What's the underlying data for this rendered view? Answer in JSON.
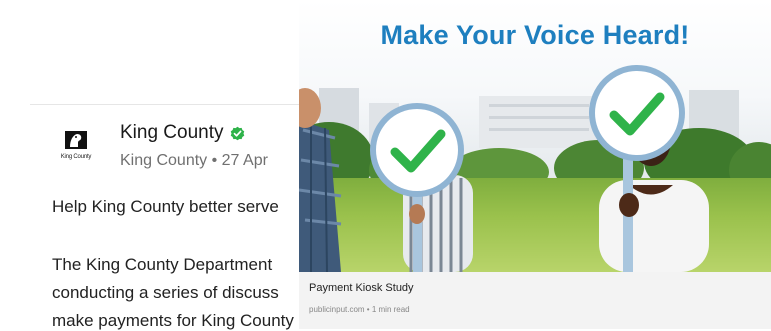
{
  "post": {
    "author": "King County",
    "meta": "King County • 27 Apr",
    "logo_text": "King County",
    "lines": [
      "Help King County better serve",
      "The King County Department",
      "conducting a series of discuss",
      "make payments for King County services better."
    ]
  },
  "card": {
    "banner": "Make Your Voice Heard!",
    "title": "Payment Kiosk Study",
    "source": "publicinput.com • 1 min read"
  },
  "colors": {
    "verified": "#2fb34a",
    "banner": "#1e7fbf",
    "check": "#2fb34a",
    "grass": "#9ac14c"
  },
  "icons": [
    "king-county-logo",
    "verified-check-icon",
    "checkmark-sign-icon"
  ]
}
